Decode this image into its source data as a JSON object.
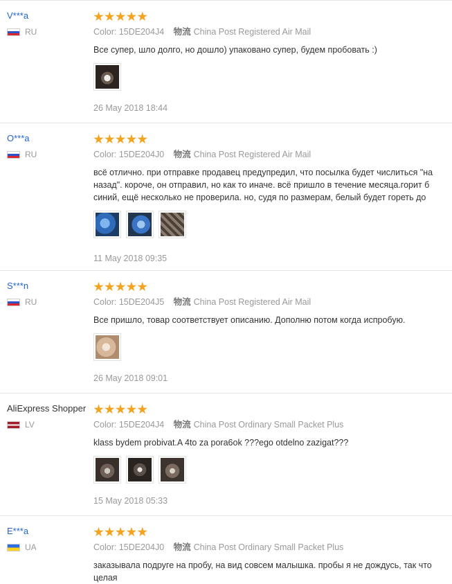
{
  "labels": {
    "color_prefix": "Color:",
    "shipping_label": "物流"
  },
  "colors": {
    "star": "#f3a31f",
    "username_link": "#2266cc",
    "muted_text": "#999999"
  },
  "reviews": [
    {
      "user": "V***a",
      "country": "RU",
      "flag": "ru",
      "rating": 5,
      "color": "15DE204J4",
      "shipping": "China Post Registered Air Mail",
      "text": [
        "Все супер, шло долго, но дошло) упаковано супер, будем пробовать :)"
      ],
      "photos": [
        "product-photo"
      ],
      "date": "26 May 2018 18:44"
    },
    {
      "user": "O***a",
      "country": "RU",
      "flag": "ru",
      "rating": 5,
      "color": "15DE204J0",
      "shipping": "China Post Registered Air Mail",
      "text": [
        "всё отлично. при отправке продавец предупредил, что посылка будет числиться \"на",
        "назад\". короче, он отправил, но как то иначе. всё пришло в течение месяца.горит б",
        "синий, ещё несколько не проверила. но, судя по размерам, белый будет гореть до"
      ],
      "photos": [
        "product-photo",
        "product-photo",
        "product-photo"
      ],
      "date": "11 May 2018 09:35"
    },
    {
      "user": "S***n",
      "country": "RU",
      "flag": "ru",
      "rating": 5,
      "color": "15DE204J5",
      "shipping": "China Post Registered Air Mail",
      "text": [
        "Все пришло, товар соответствует описанию. Дополню потом когда испробую."
      ],
      "photos": [
        "product-photo"
      ],
      "date": "26 May 2018 09:01"
    },
    {
      "user": "AliExpress Shopper",
      "country": "LV",
      "flag": "lv",
      "rating": 5,
      "color": "15DE204J4",
      "shipping": "China Post Ordinary Small Packet Plus",
      "text": [
        "klass bydem probivat.A 4to za pora6ok ???ego otdelno zazigat???"
      ],
      "photos": [
        "product-photo",
        "product-photo",
        "product-photo"
      ],
      "date": "15 May 2018 05:33"
    },
    {
      "user": "E***a",
      "country": "UA",
      "flag": "ua",
      "rating": 5,
      "color": "15DE204J0",
      "shipping": "China Post Ordinary Small Packet Plus",
      "text": [
        "заказывала подруге на пробу, на вид совсем малышка. пробы я не дождусь, так что",
        "целая"
      ],
      "photos": [],
      "date": ""
    }
  ]
}
